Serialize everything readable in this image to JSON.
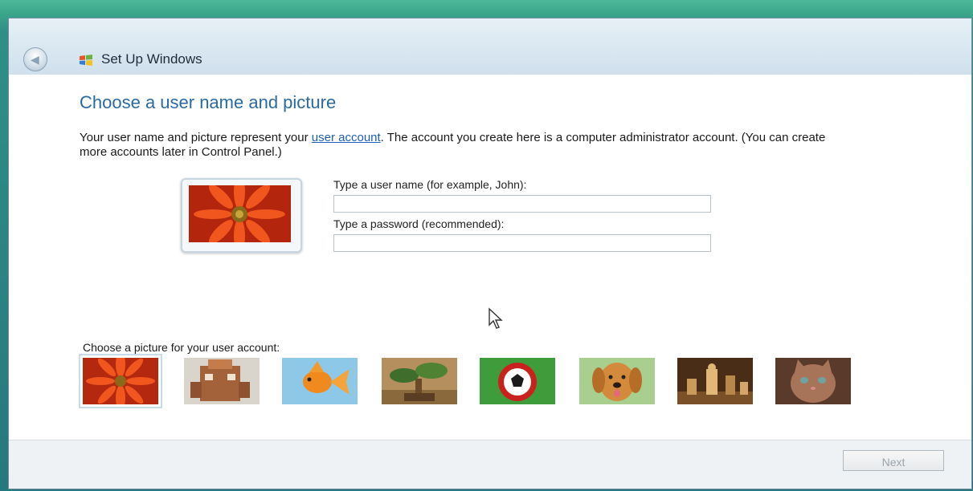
{
  "window": {
    "title": "Set Up Windows"
  },
  "content": {
    "heading": "Choose a user name and picture",
    "description_part1": "Your user name and picture represent your ",
    "description_link": "user account",
    "description_part2": ". The account you create here is a computer administrator account. (You can create more accounts later in Control Panel.)",
    "username_label": "Type a user name (for example, John):",
    "username_value": "",
    "password_label": "Type a password (recommended):",
    "password_value": "",
    "pictures_label": "Choose a picture for your user account:",
    "pictures": [
      {
        "name": "orange-flower",
        "selected": true
      },
      {
        "name": "robot-toy",
        "selected": false
      },
      {
        "name": "goldfish",
        "selected": false
      },
      {
        "name": "bonsai-tree",
        "selected": false
      },
      {
        "name": "soccer-ball",
        "selected": false
      },
      {
        "name": "puppy",
        "selected": false
      },
      {
        "name": "chess-pieces",
        "selected": false
      },
      {
        "name": "kitten",
        "selected": false
      }
    ]
  },
  "footer": {
    "next_label": "Next"
  },
  "colors": {
    "heading": "#2a6aa3",
    "link": "#1d5fb5",
    "desktop": "#2f8f86"
  },
  "icons": [
    "back-arrow-icon",
    "windows-logo-icon",
    "mouse-cursor-icon"
  ]
}
